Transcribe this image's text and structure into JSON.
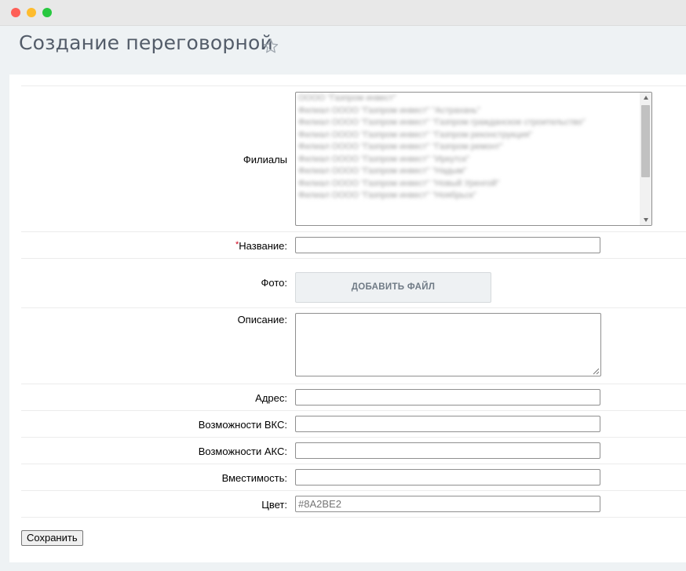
{
  "window": {
    "controls": [
      "close",
      "minimize",
      "maximize"
    ]
  },
  "header": {
    "title": "Создание переговорной",
    "favorite_icon": "star-outline-icon"
  },
  "form": {
    "branches": {
      "label": "Филиалы",
      "options": [
        "ОООО \"Газпром инвест\"",
        "Филиал ОООО \"Газпром инвест\" \"Астрахань\"",
        "Филиал ОООО \"Газпром инвест\" \"Газпром гражданское строительство\"",
        "Филиал ОООО \"Газпром инвест\" \"Газпром реконструкция\"",
        "Филиал ОООО \"Газпром инвест\" \"Газпром ремонт\"",
        "Филиал ОООО \"Газпром инвест\" \"Иркутск\"",
        "Филиал ОООО \"Газпром инвест\" \"Надым\"",
        "Филиал ОООО \"Газпром инвест\" \"Новый Уренгой\"",
        "Филиал ОООО \"Газпром инвест\" \"Ноябрьск\""
      ]
    },
    "name": {
      "label": "Название:",
      "required_mark": "*",
      "value": ""
    },
    "photo": {
      "label": "Фото:",
      "button_label": "ДОБАВИТЬ ФАЙЛ"
    },
    "description": {
      "label": "Описание:",
      "value": ""
    },
    "address": {
      "label": "Адрес:",
      "value": ""
    },
    "vks": {
      "label": "Возможности ВКС:",
      "value": ""
    },
    "aks": {
      "label": "Возможности АКС:",
      "value": ""
    },
    "capacity": {
      "label": "Вместимость:",
      "value": ""
    },
    "color": {
      "label": "Цвет:",
      "value": "#8A2BE2"
    },
    "submit_label": "Сохранить"
  }
}
